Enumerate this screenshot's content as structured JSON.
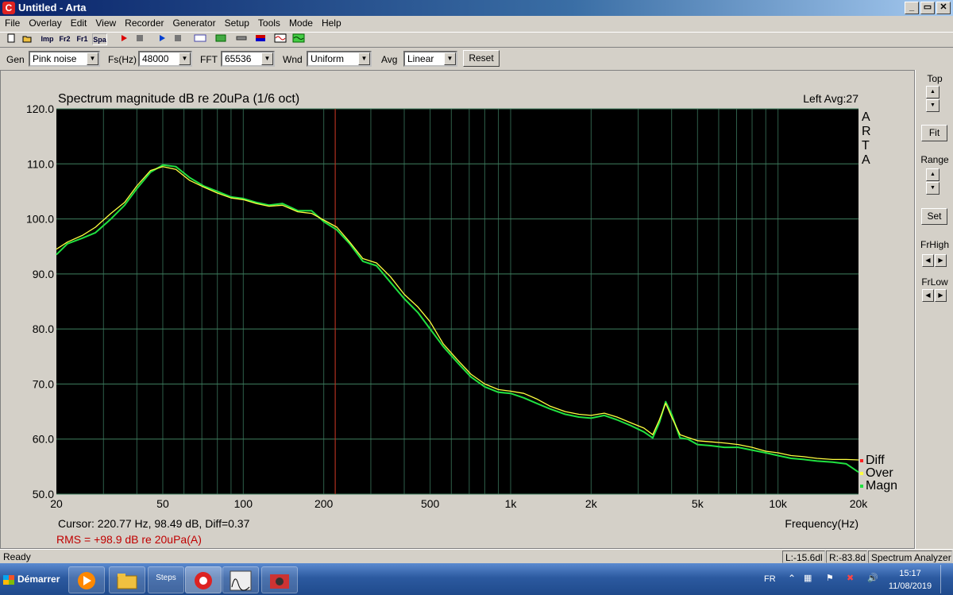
{
  "window": {
    "title": "Untitled - Arta",
    "icon_letter": "C",
    "min_glyph": "_",
    "restore_glyph": "▭",
    "close_glyph": "✕"
  },
  "menu": [
    "File",
    "Overlay",
    "Edit",
    "View",
    "Recorder",
    "Generator",
    "Setup",
    "Tools",
    "Mode",
    "Help"
  ],
  "toolbar": {
    "icons": [
      "new-icon",
      "open-icon",
      "imp-icon",
      "fr2-icon",
      "fr1-icon",
      "spa-icon",
      "record-icon",
      "stop-icon",
      "play-icon",
      "stop-play-icon",
      "rec-icon",
      "measure-icon",
      "level-icon",
      "color-icon",
      "wave-icon",
      "pink-icon"
    ],
    "imp": "Imp",
    "fr2": "Fr2",
    "fr1": "Fr1",
    "spa": "Spa"
  },
  "generator_bar": {
    "gen_label": "Gen",
    "gen_value": "Pink noise",
    "fs_label": "Fs(Hz)",
    "fs_value": "48000",
    "fft_label": "FFT",
    "fft_value": "65536",
    "wnd_label": "Wnd",
    "wnd_value": "Uniform",
    "avg_label": "Avg",
    "avg_value": "Linear",
    "reset_label": "Reset"
  },
  "plot": {
    "title": "Spectrum magnitude dB re 20uPa (1/6 oct)",
    "channel": "Left  Avg:27",
    "brand": [
      "A",
      "R",
      "T",
      "A"
    ],
    "cursor": "Cursor:   220.77 Hz, 98.49 dB,  Diff=0.37",
    "rms": "RMS =  +98.9 dB re 20uPa(A)",
    "legend": [
      {
        "label": "Diff",
        "color": "#ff2020"
      },
      {
        "label": "Over",
        "color": "#ffff40"
      },
      {
        "label": "Magn",
        "color": "#20e040"
      }
    ]
  },
  "chart_data": {
    "type": "line",
    "title": "Spectrum magnitude dB re 20uPa (1/6 oct)",
    "xlabel": "Frequency(Hz)",
    "ylabel": "",
    "x_scale": "log",
    "xlim": [
      20,
      20000
    ],
    "ylim": [
      50,
      120
    ],
    "x_ticks": [
      20,
      50,
      100,
      200,
      500,
      1000,
      2000,
      5000,
      10000,
      20000
    ],
    "x_tick_labels": [
      "20",
      "50",
      "100",
      "200",
      "500",
      "1k",
      "2k",
      "5k",
      "10k",
      "20k"
    ],
    "y_ticks": [
      50,
      60,
      70,
      80,
      90,
      100,
      110,
      120
    ],
    "y_tick_labels": [
      "50.0",
      "60.0",
      "70.0",
      "80.0",
      "90.0",
      "100.0",
      "110.0",
      "120.0"
    ],
    "cursor_x": 220.77,
    "grid": true,
    "series": [
      {
        "name": "Magn",
        "color": "#20e040",
        "x": [
          20,
          22,
          25,
          28,
          32,
          36,
          40,
          45,
          50,
          56,
          63,
          71,
          80,
          90,
          100,
          112,
          125,
          140,
          160,
          180,
          200,
          224,
          250,
          280,
          315,
          355,
          400,
          450,
          500,
          560,
          630,
          710,
          800,
          900,
          1000,
          1120,
          1250,
          1400,
          1600,
          1800,
          2000,
          2240,
          2500,
          2800,
          3150,
          3400,
          3600,
          3800,
          4000,
          4300,
          4600,
          5000,
          5600,
          6300,
          7100,
          8000,
          9000,
          10000,
          11200,
          12500,
          14000,
          16000,
          18000,
          20000
        ],
        "y": [
          93.5,
          95.5,
          96.5,
          97.5,
          100.0,
          102.5,
          105.5,
          108.5,
          109.8,
          109.5,
          107.5,
          106.0,
          105.0,
          104.0,
          103.7,
          103.0,
          102.5,
          102.8,
          101.5,
          101.5,
          99.5,
          98.0,
          95.5,
          92.3,
          91.5,
          88.5,
          85.5,
          83.0,
          80.0,
          76.8,
          74.0,
          71.3,
          69.5,
          68.5,
          68.3,
          67.5,
          66.5,
          65.5,
          64.5,
          64.0,
          63.8,
          64.3,
          63.5,
          62.5,
          61.3,
          60.2,
          63.0,
          66.8,
          64.5,
          60.2,
          60.0,
          59.0,
          58.8,
          58.5,
          58.5,
          58.0,
          57.5,
          57.0,
          56.5,
          56.3,
          56.0,
          55.8,
          55.5,
          54.0
        ]
      },
      {
        "name": "Over",
        "color": "#ffff40",
        "x": [
          20,
          22,
          25,
          28,
          32,
          36,
          40,
          45,
          50,
          56,
          63,
          71,
          80,
          90,
          100,
          112,
          125,
          140,
          160,
          180,
          200,
          224,
          250,
          280,
          315,
          355,
          400,
          450,
          500,
          560,
          630,
          710,
          800,
          900,
          1000,
          1120,
          1250,
          1400,
          1600,
          1800,
          2000,
          2240,
          2500,
          2800,
          3150,
          3400,
          3600,
          3800,
          4000,
          4300,
          4600,
          5000,
          5600,
          6300,
          7100,
          8000,
          9000,
          10000,
          11200,
          12500,
          14000,
          16000,
          18000,
          20000
        ],
        "y": [
          94.5,
          95.8,
          97.0,
          98.5,
          101.0,
          103.0,
          106.0,
          108.8,
          109.5,
          109.0,
          107.0,
          105.8,
          104.7,
          103.8,
          103.5,
          102.8,
          102.3,
          102.5,
          101.3,
          101.0,
          99.8,
          98.5,
          95.8,
          92.8,
          92.0,
          89.5,
          86.3,
          84.0,
          81.3,
          77.3,
          74.5,
          71.8,
          70.0,
          69.0,
          68.7,
          68.3,
          67.3,
          66.0,
          65.0,
          64.5,
          64.3,
          64.7,
          64.0,
          63.0,
          62.0,
          60.8,
          63.5,
          66.5,
          64.0,
          60.8,
          60.3,
          59.7,
          59.5,
          59.3,
          59.0,
          58.5,
          57.8,
          57.5,
          57.0,
          56.8,
          56.5,
          56.3,
          56.3,
          56.2
        ]
      }
    ]
  },
  "right_panel": {
    "top_label": "Top",
    "fit_label": "Fit",
    "range_label": "Range",
    "set_label": "Set",
    "frhigh_label": "FrHigh",
    "frlow_label": "FrLow",
    "up_glyph": "▲",
    "down_glyph": "▼",
    "left_glyph": "◀",
    "right_glyph": "▶"
  },
  "status": {
    "ready": "Ready",
    "left": "L:-15.6dl",
    "right": "R:-83.8d",
    "mode": "Spectrum Analyzer"
  },
  "taskbar": {
    "start_label": "Démarrer",
    "steps_label": "Steps",
    "lang": "FR",
    "time": "15:17",
    "date": "11/08/2019"
  }
}
